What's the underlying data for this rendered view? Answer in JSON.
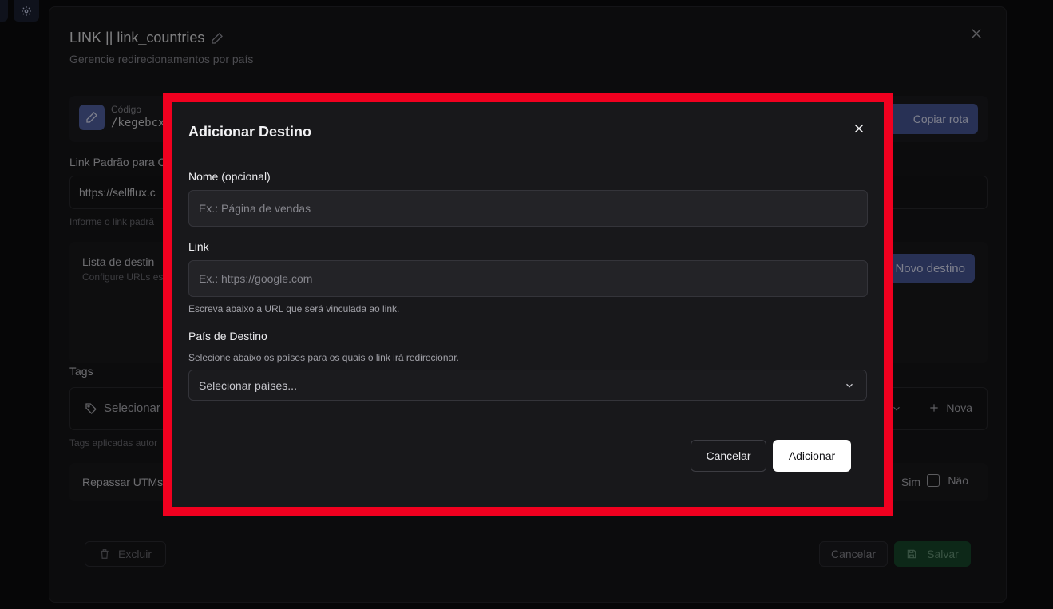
{
  "panel": {
    "title": "LINK || link_countries",
    "subtitle": "Gerencie redirecionamentos por país",
    "code_label": "Código",
    "code_value": "/kegebcx",
    "copy_label": "Copiar rota",
    "default_link_label": "Link Padrão para C",
    "default_link_value": "https://sellflux.c",
    "default_link_hint": "Informe o link padrã",
    "dest_list_title": "Lista de destin",
    "dest_list_sub": "Configure URLs es",
    "new_dest_label": "Novo destino",
    "tags_label": "Tags",
    "tags_placeholder": "Selecionar",
    "tags_new_label": "Nova",
    "tags_hint": "Tags aplicadas autor",
    "utm_label": "Repassar UTMs",
    "utm_yes": "Sim",
    "utm_no": "Não",
    "delete_label": "Excluir",
    "cancel_label": "Cancelar",
    "save_label": "Salvar"
  },
  "modal": {
    "title": "Adicionar Destino",
    "name_label": "Nome (opcional)",
    "name_placeholder": "Ex.: Página de vendas",
    "link_label": "Link",
    "link_placeholder": "Ex.: https://google.com",
    "link_hint": "Escreva abaixo a URL que será vinculada ao link.",
    "country_label": "País de Destino",
    "country_hint": "Selecione abaixo os países para os quais o link irá redirecionar.",
    "country_placeholder": "Selecionar países...",
    "cancel_label": "Cancelar",
    "add_label": "Adicionar"
  },
  "colors": {
    "highlight": "#f0001f",
    "accent": "#4a5a9c",
    "save": "#184a2c"
  }
}
